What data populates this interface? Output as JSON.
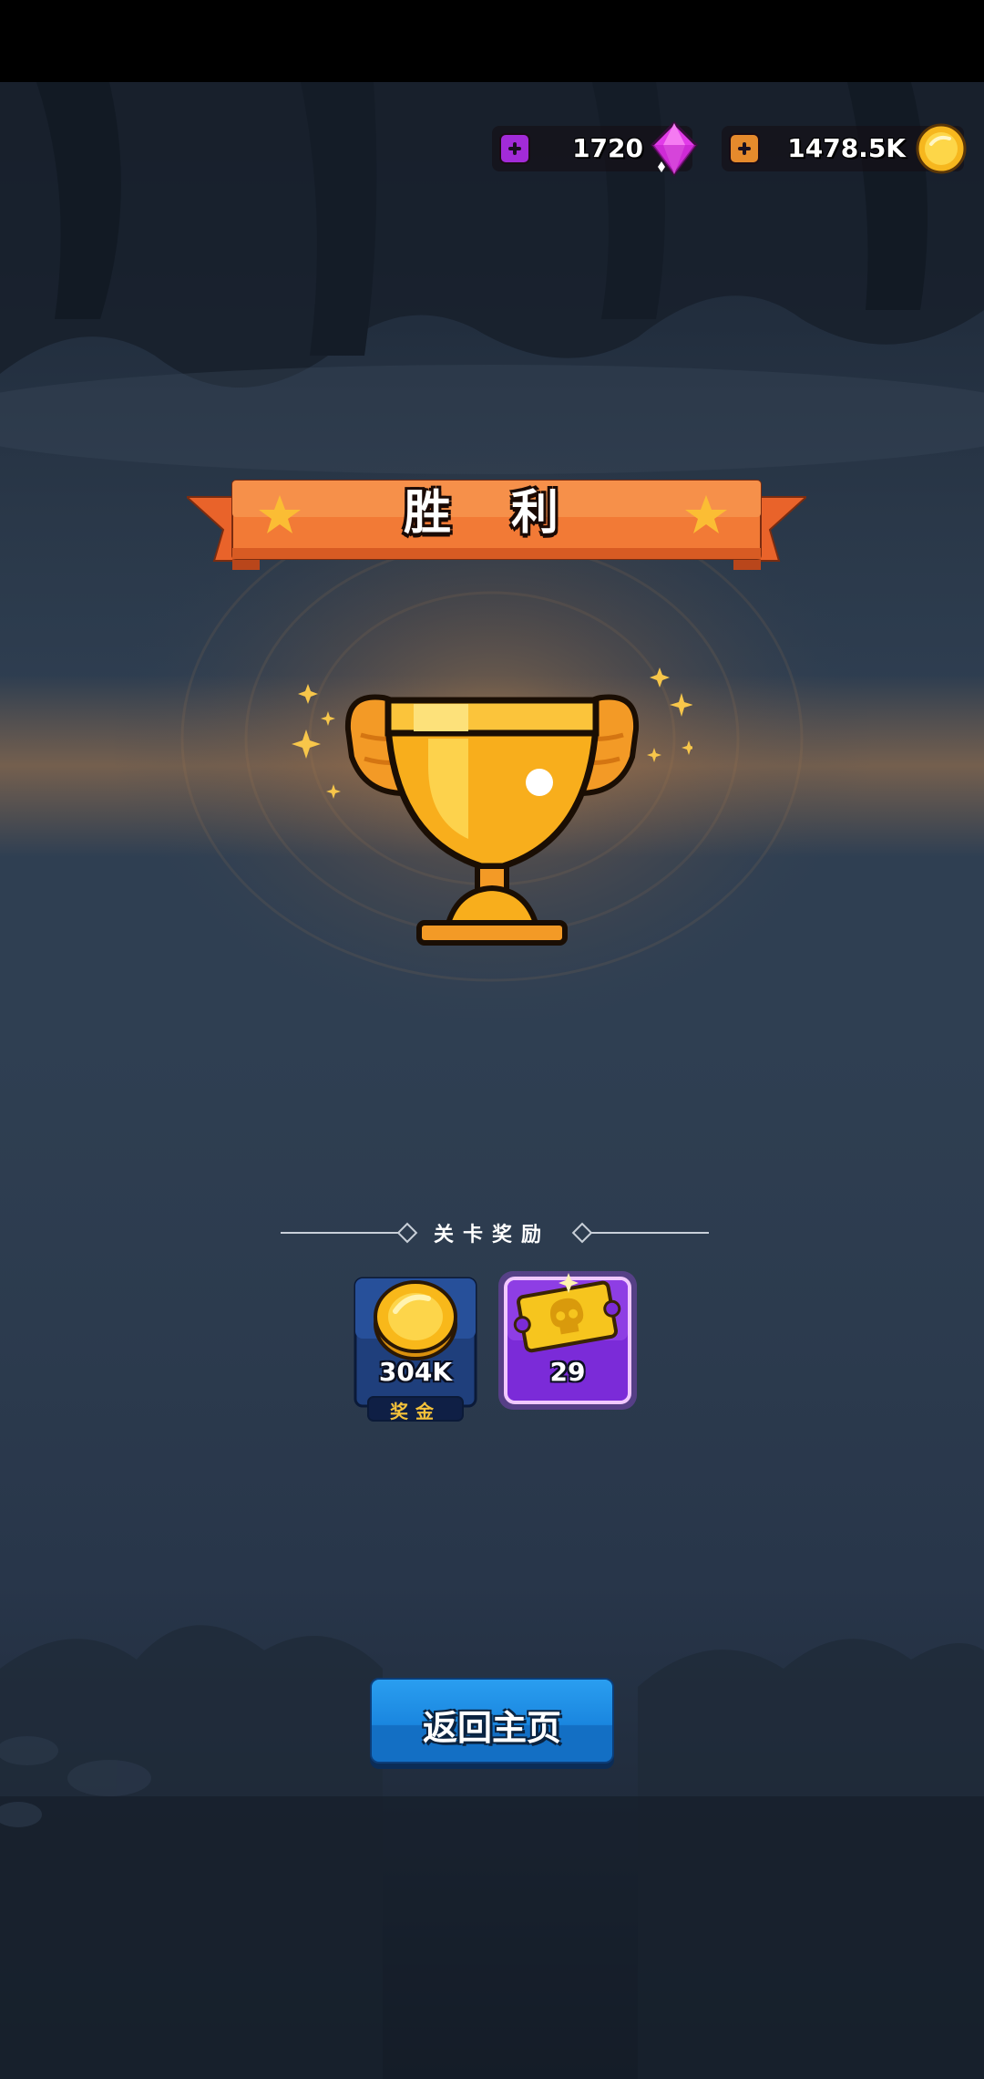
{
  "currency": {
    "gems": {
      "amount": "1720",
      "icon": "gem-icon",
      "plus_icon": "plus-icon",
      "accent": "#a22bd8"
    },
    "coins": {
      "amount": "1478.5K",
      "icon": "coin-icon",
      "plus_icon": "plus-icon",
      "accent": "#e58a2c"
    }
  },
  "result": {
    "title": "胜 利",
    "banner_color": "#f27a36",
    "trophy_icon": "trophy-icon"
  },
  "rewards": {
    "title": "关卡奖励",
    "items": [
      {
        "icon": "coin-stack-icon",
        "amount": "304K",
        "label": "奖金"
      },
      {
        "icon": "skull-ticket-icon",
        "amount": "29"
      }
    ]
  },
  "actions": {
    "home_label": "返回主页"
  }
}
